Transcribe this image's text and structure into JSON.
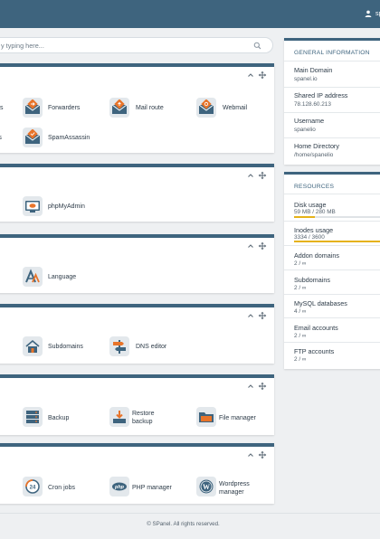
{
  "topbar": {
    "user_name": "sp"
  },
  "search": {
    "placeholder": "y typing here..."
  },
  "panels": [
    {
      "tiles": [
        {
          "label": "Forwarders",
          "icon": "mail-forward-icon"
        },
        {
          "label": "Mail route",
          "icon": "mail-route-icon"
        },
        {
          "label": "Webmail",
          "icon": "webmail-icon"
        },
        {
          "label": "SpamAssassin",
          "icon": "spam-shield-icon"
        }
      ],
      "edge_labels": [
        "s",
        "rs"
      ]
    },
    {
      "tiles": [
        {
          "label": "phpMyAdmin",
          "icon": "phpmyadmin-icon"
        }
      ]
    },
    {
      "tiles": [
        {
          "label": "Language",
          "icon": "language-icon"
        }
      ]
    },
    {
      "tiles": [
        {
          "label": "Subdomains",
          "icon": "subdomains-icon"
        },
        {
          "label": "DNS editor",
          "icon": "dns-signpost-icon"
        }
      ]
    },
    {
      "tiles": [
        {
          "label": "Backup",
          "icon": "backup-icon"
        },
        {
          "label": "Restore",
          "label2": "backup",
          "icon": "restore-backup-icon"
        },
        {
          "label": "File manager",
          "icon": "folder-icon"
        }
      ]
    },
    {
      "tiles": [
        {
          "label": "Cron jobs",
          "icon": "cron-clock-icon"
        },
        {
          "label": "PHP manager",
          "icon": "php-icon"
        },
        {
          "label": "Wordpress",
          "label2": "manager",
          "icon": "wordpress-icon"
        }
      ]
    }
  ],
  "general": {
    "title": "GENERAL INFORMATION",
    "items": [
      {
        "label": "Main Domain",
        "value": "spanel.io"
      },
      {
        "label": "Shared IP address",
        "value": "78.128.60.213"
      },
      {
        "label": "Username",
        "value": "spanelio"
      },
      {
        "label": "Home Directory",
        "value": "/home/spanelio"
      }
    ]
  },
  "resources": {
    "title": "RESOURCES",
    "items": [
      {
        "label": "Disk usage",
        "value": "59 MB / 280 MB",
        "fill": 0.21
      },
      {
        "label": "Inodes usage",
        "value": "3334 / 3600",
        "fill": 0.926
      },
      {
        "label": "Addon domains",
        "value": "2 / ∞"
      },
      {
        "label": "Subdomains",
        "value": "2 / ∞"
      },
      {
        "label": "MySQL databases",
        "value": "4 / ∞"
      },
      {
        "label": "Email accounts",
        "value": "2 / ∞"
      },
      {
        "label": "FTP accounts",
        "value": "2 / ∞"
      }
    ]
  },
  "footer": {
    "text": "© SPanel. All rights reserved."
  },
  "colors": {
    "topbar": "#3e647e",
    "accent": "#3e647e",
    "icon_orange": "#e8742a",
    "usage_bar": "#e5b219"
  }
}
